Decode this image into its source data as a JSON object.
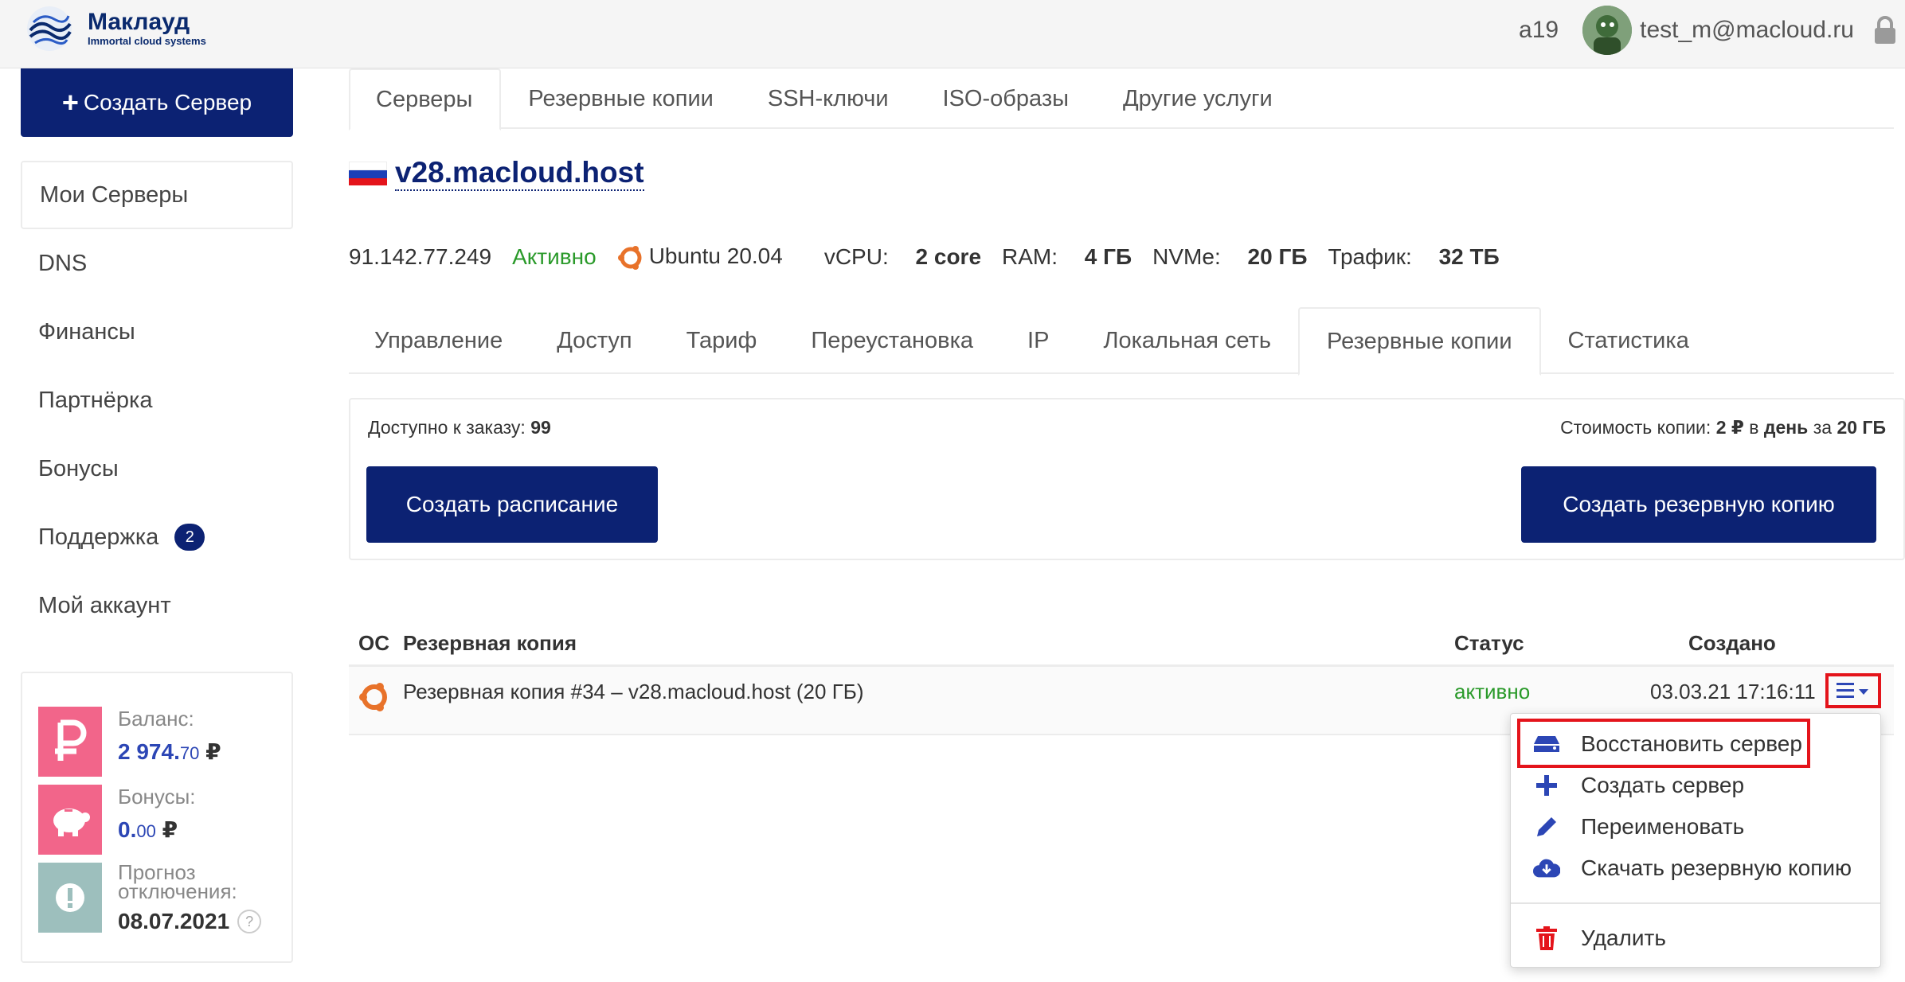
{
  "brand": {
    "title": "Маклауд",
    "subtitle": "Immortal cloud systems"
  },
  "topbar": {
    "account_id": "a19",
    "user_email": "test_m@macloud.ru"
  },
  "sidebar": {
    "create_button": "Создать Сервер",
    "items": [
      {
        "label": "Мои Серверы"
      },
      {
        "label": "DNS"
      },
      {
        "label": "Финансы"
      },
      {
        "label": "Партнёрка"
      },
      {
        "label": "Бонусы"
      },
      {
        "label": "Поддержка",
        "badge": "2"
      },
      {
        "label": "Мой аккаунт"
      }
    ],
    "balance": {
      "label": "Баланс:",
      "int": "2 974.",
      "dec": "70",
      "cur": "₽",
      "bonus_label": "Бонусы:",
      "bonus_int": "0.",
      "bonus_dec": "00",
      "bonus_cur": "₽",
      "forecast_label": "Прогноз отключения:",
      "forecast_date": "08.07.2021",
      "help": "?"
    },
    "colors": {
      "pink": "#f2658a",
      "teal": "#9dbfbd"
    }
  },
  "main_tabs": [
    "Серверы",
    "Резервные копии",
    "SSH-ключи",
    "ISO-образы",
    "Другие услуги"
  ],
  "server": {
    "host": "v28.macloud.host",
    "ip": "91.142.77.249",
    "state": "Активно",
    "os": "Ubuntu 20.04",
    "vcpu_label": "vCPU:",
    "vcpu": "2 core",
    "ram_label": "RAM:",
    "ram": "4 ГБ",
    "nvme_label": "NVMe:",
    "nvme": "20 ГБ",
    "traffic_label": "Трафик:",
    "traffic": "32 ТБ"
  },
  "server_tabs": [
    "Управление",
    "Доступ",
    "Тариф",
    "Переустановка",
    "IP",
    "Локальная сеть",
    "Резервные копии",
    "Статистика"
  ],
  "backups": {
    "available_label": "Доступно к заказу:",
    "available": "99",
    "cost_prefix": "Стоимость копии:",
    "cost_price": "2 ₽",
    "cost_in": "в",
    "cost_day": "день",
    "cost_for": "за",
    "cost_size": "20 ГБ",
    "schedule_button": "Создать расписание",
    "create_button": "Создать резервную копию",
    "columns": {
      "os": "ОС",
      "name": "Резервная копия",
      "status": "Статус",
      "created": "Создано"
    },
    "rows": [
      {
        "name": "Резервная копия #34 – v28.macloud.host (20 ГБ)",
        "status": "активно",
        "created": "03.03.21 17:16:11"
      }
    ]
  },
  "row_menu": {
    "restore": "Восстановить сервер",
    "create_server": "Создать сервер",
    "rename": "Переименовать",
    "download": "Скачать резервную копию",
    "delete": "Удалить"
  }
}
